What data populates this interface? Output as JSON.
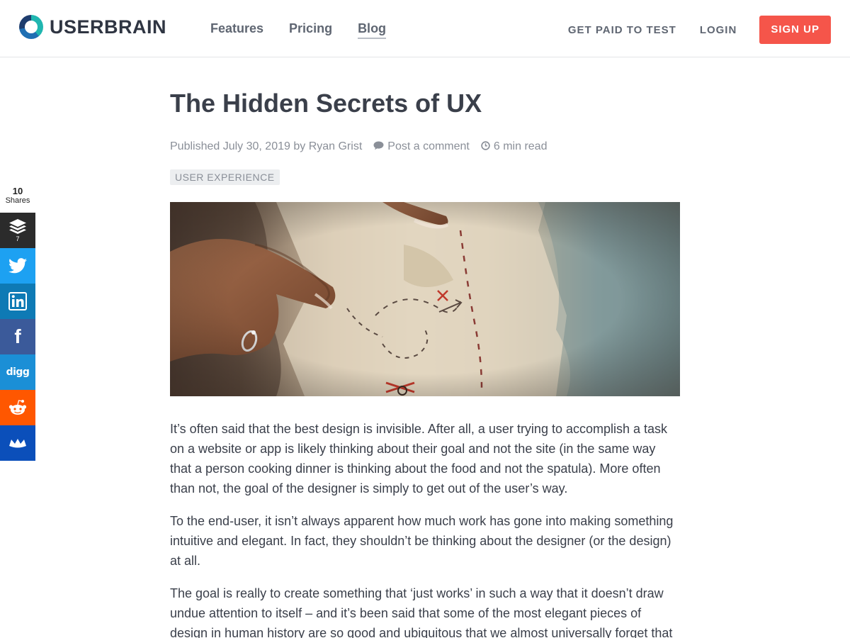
{
  "header": {
    "brand": "USERBRAIN",
    "nav": [
      "Features",
      "Pricing",
      "Blog"
    ],
    "active_nav": "Blog",
    "get_paid": "GET PAID TO TEST",
    "login": "LOGIN",
    "signup": "SIGN UP"
  },
  "share": {
    "count": "10",
    "count_label": "Shares",
    "buffer_count": "7",
    "buttons": [
      "buffer-icon",
      "twitter-icon",
      "linkedin-icon",
      "facebook-icon",
      "digg-icon",
      "reddit-icon",
      "sumo-icon"
    ],
    "digg_text": "digg",
    "facebook_text": "f"
  },
  "article": {
    "title": "The Hidden Secrets of UX",
    "published": "Published July 30, 2019 by Ryan Grist",
    "comment": "Post a comment",
    "read_time": "6 min read",
    "tag": "USER EXPERIENCE",
    "paragraphs": [
      "It’s often said that the best design is invisible. After all, a user trying to accomplish a task on a website or app is likely thinking about their goal and not the site (in the same way that a person cooking dinner is thinking about the food and not the spatula). More often than not, the goal of the designer is simply to get out of the user’s way.",
      "To the end-user, it isn’t always apparent how much work has gone into making something intuitive and elegant. In fact, they shouldn’t be thinking about the designer (or the design) at all.",
      "The goal is really to create something that ‘just works’ in such a way that it doesn’t draw undue attention to itself – and it’s been said that some of the most elegant pieces of design in human history are so good and ubiquitous that we almost universally forget that"
    ]
  },
  "colors": {
    "signup_bg": "#f5554a",
    "buffer": "#2b2b2b",
    "twitter": "#1da1f2",
    "linkedin": "#0e7ab5",
    "facebook": "#3b5a9a",
    "digg": "#1b8fd6",
    "reddit": "#ff5700",
    "sumo": "#0b4fba"
  }
}
